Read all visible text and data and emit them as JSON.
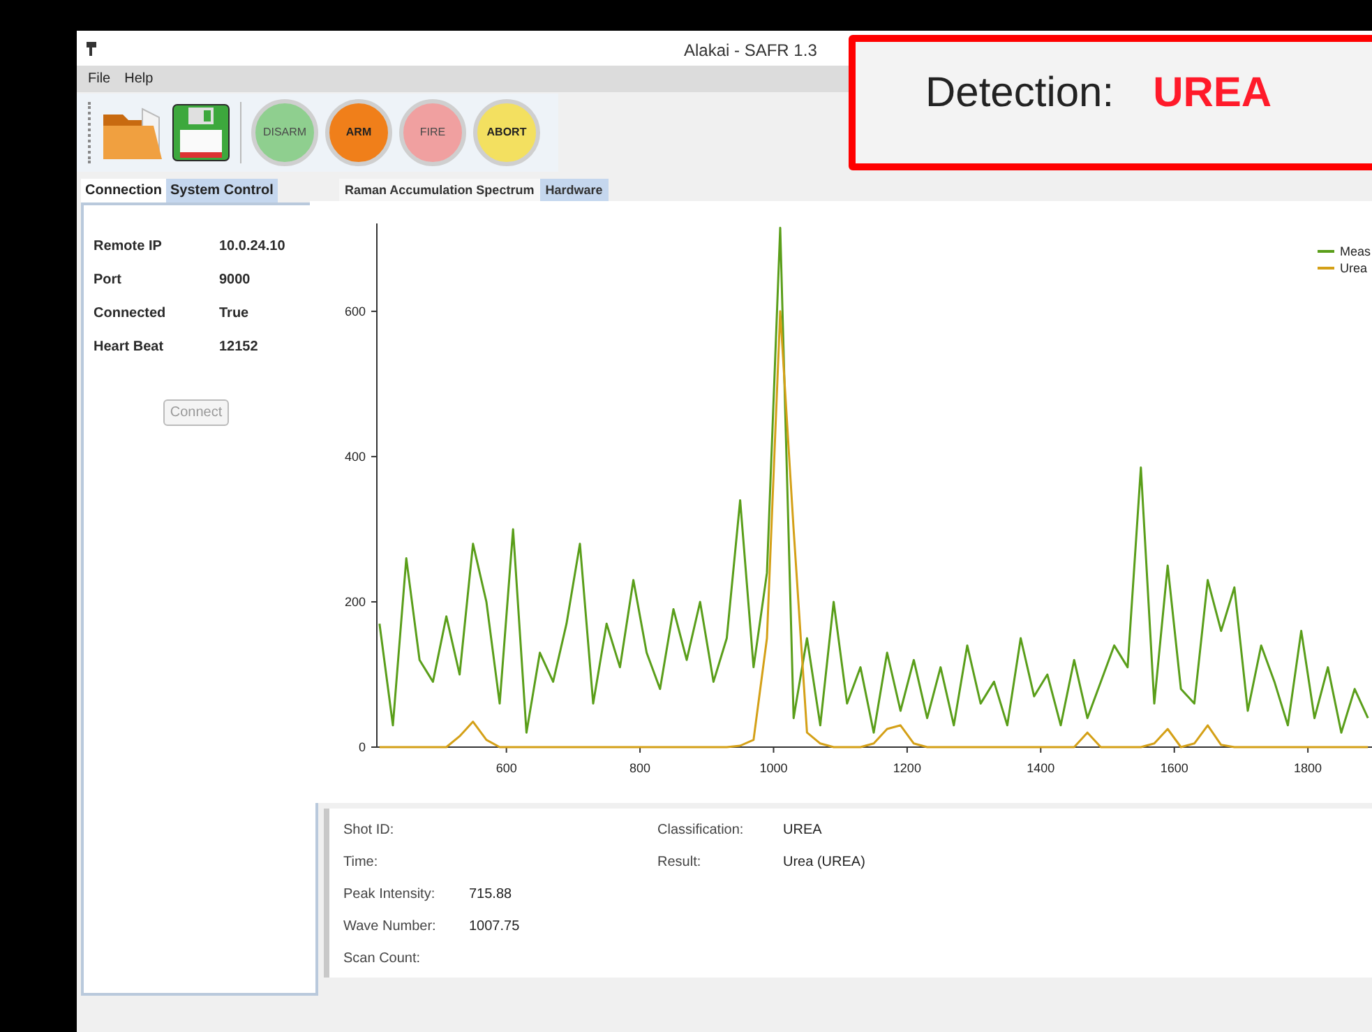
{
  "window": {
    "title": "Alakai - SAFR 1.3"
  },
  "menu": [
    "File",
    "Help"
  ],
  "toolbar": {
    "file_buttons": [
      {
        "kind": "folder"
      },
      {
        "kind": "save"
      }
    ],
    "action_buttons": [
      {
        "label": "DISARM",
        "color": "#8fcf8f",
        "disabled": true
      },
      {
        "label": "ARM",
        "color": "#f07f1a",
        "disabled": false
      },
      {
        "label": "FIRE",
        "color": "#f0a0a0",
        "disabled": true
      },
      {
        "label": "ABORT",
        "color": "#f3e060",
        "disabled": false
      }
    ]
  },
  "detection": {
    "label": "Detection:",
    "value": "UREA"
  },
  "left_tabs": [
    {
      "label": "Connection",
      "selected": true
    },
    {
      "label": "System Control",
      "selected": false
    }
  ],
  "connection": {
    "fields": [
      {
        "label": "Remote IP",
        "value": "10.0.24.10"
      },
      {
        "label": "Port",
        "value": "9000"
      },
      {
        "label": "Connected",
        "value": "True"
      },
      {
        "label": "Heart Beat",
        "value": "12152"
      }
    ],
    "button": {
      "label": "Connect",
      "disabled": true
    }
  },
  "right_tabs": [
    {
      "label": "Raman Accumulation Spectrum",
      "selected": true
    },
    {
      "label": "Hardware",
      "selected": false
    }
  ],
  "chart_data": {
    "type": "line",
    "legend": true,
    "xlim": [
      406,
      1896
    ],
    "ylim": [
      0,
      721
    ],
    "xticks": [
      600,
      800,
      1000,
      1200,
      1400,
      1600,
      1800
    ],
    "yticks": [
      0,
      200,
      400,
      600
    ],
    "x": [
      410,
      430,
      450,
      470,
      490,
      510,
      530,
      550,
      570,
      590,
      610,
      630,
      650,
      670,
      690,
      710,
      730,
      750,
      770,
      790,
      810,
      830,
      850,
      870,
      890,
      910,
      930,
      950,
      970,
      990,
      1010,
      1030,
      1050,
      1070,
      1090,
      1110,
      1130,
      1150,
      1170,
      1190,
      1210,
      1230,
      1250,
      1270,
      1290,
      1310,
      1330,
      1350,
      1370,
      1390,
      1410,
      1430,
      1450,
      1470,
      1490,
      1510,
      1530,
      1550,
      1570,
      1590,
      1610,
      1630,
      1650,
      1670,
      1690,
      1710,
      1730,
      1750,
      1770,
      1790,
      1810,
      1830,
      1850,
      1870,
      1890
    ],
    "series": [
      {
        "name": "Meas",
        "color": "#5a9e1a",
        "values": [
          170,
          30,
          260,
          120,
          90,
          180,
          100,
          280,
          200,
          60,
          300,
          20,
          130,
          90,
          170,
          280,
          60,
          170,
          110,
          230,
          130,
          80,
          190,
          120,
          200,
          90,
          150,
          340,
          110,
          240,
          715,
          40,
          150,
          30,
          200,
          60,
          110,
          20,
          130,
          50,
          120,
          40,
          110,
          30,
          140,
          60,
          90,
          30,
          150,
          70,
          100,
          30,
          120,
          40,
          90,
          140,
          110,
          385,
          60,
          250,
          80,
          60,
          230,
          160,
          220,
          50,
          140,
          90,
          30,
          160,
          40,
          110,
          20,
          80,
          40
        ]
      },
      {
        "name": "Urea",
        "color": "#d4a017",
        "values": [
          0,
          0,
          0,
          0,
          0,
          0,
          15,
          35,
          10,
          0,
          0,
          0,
          0,
          0,
          0,
          0,
          0,
          0,
          0,
          0,
          0,
          0,
          0,
          0,
          0,
          0,
          0,
          2,
          10,
          150,
          600,
          300,
          20,
          5,
          0,
          0,
          0,
          5,
          25,
          30,
          5,
          0,
          0,
          0,
          0,
          0,
          0,
          0,
          0,
          0,
          0,
          0,
          0,
          20,
          0,
          0,
          0,
          0,
          5,
          25,
          0,
          5,
          30,
          3,
          0,
          0,
          0,
          0,
          0,
          0,
          0,
          0,
          0,
          0,
          0
        ]
      }
    ]
  },
  "results": {
    "left": [
      {
        "label": "Shot ID:"
      },
      {
        "label": "Time:"
      },
      {
        "label": "Peak Intensity:",
        "value": "715.88"
      },
      {
        "label": "Wave Number:",
        "value": "1007.75"
      },
      {
        "label": "Scan Count:"
      }
    ],
    "right": [
      {
        "label": "Classification:",
        "value": "UREA"
      },
      {
        "label": "Result:",
        "value": "Urea (UREA)"
      }
    ]
  }
}
